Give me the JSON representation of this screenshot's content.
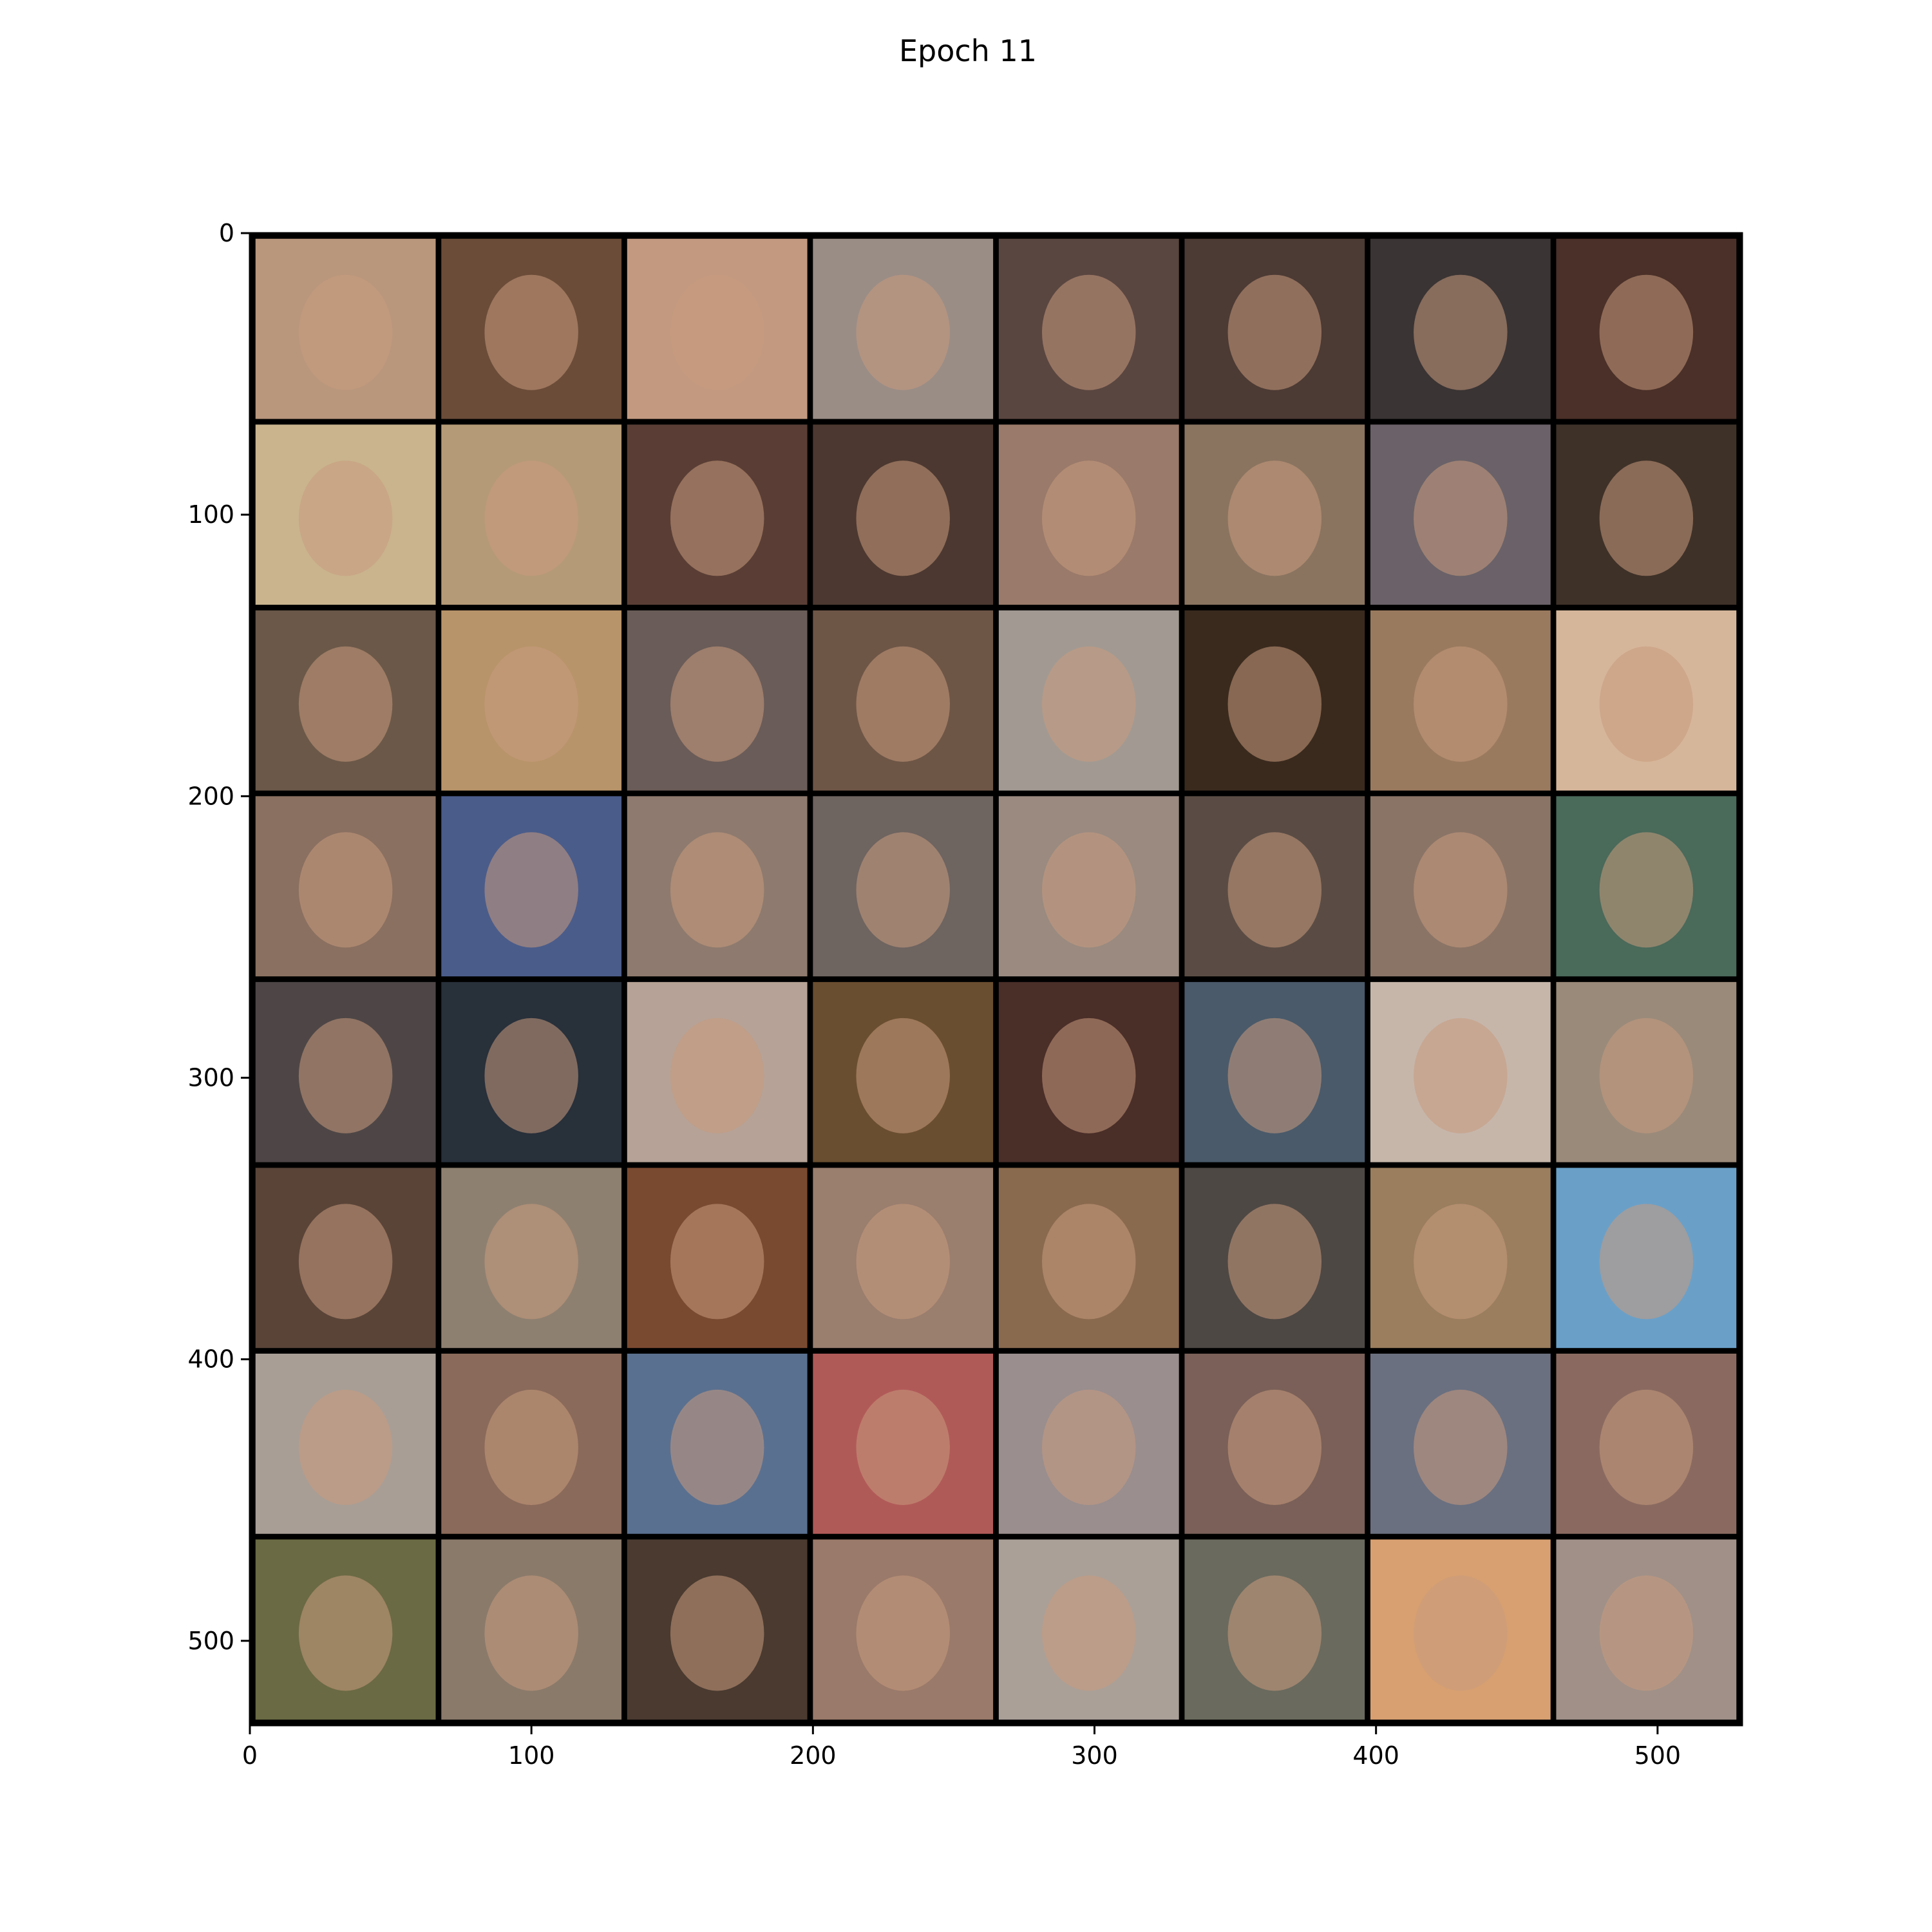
{
  "chart_data": {
    "type": "image-grid",
    "title": "Epoch 11",
    "xlabel": "",
    "ylabel": "",
    "xlim": [
      0,
      530
    ],
    "ylim": [
      530,
      0
    ],
    "xticks": [
      0,
      100,
      200,
      300,
      400,
      500
    ],
    "yticks": [
      0,
      100,
      200,
      300,
      400,
      500
    ],
    "grid_rows": 8,
    "grid_cols": 8,
    "tile_size": 64,
    "padding": 2,
    "cells": [
      [
        "#b9977c",
        "#6b4c38",
        "#c39a80",
        "#9a8d86",
        "#5a4640",
        "#4c3a34",
        "#3a3434",
        "#4a3028"
      ],
      [
        "#c9b48e",
        "#b59a77",
        "#5a3e35",
        "#4c3830",
        "#9a7a6a",
        "#8a7460",
        "#6a6268",
        "#3e3128"
      ],
      [
        "#6b5848",
        "#b8946a",
        "#6a5c58",
        "#6e5646",
        "#a29a92",
        "#3a2a1e",
        "#9a7a5e",
        "#d6b69a"
      ],
      [
        "#8a7060",
        "#4a5c8a",
        "#8e7a6e",
        "#6e6460",
        "#9a8a80",
        "#5a4c44",
        "#8a7466",
        "#4a6a5a"
      ],
      [
        "#4e4646",
        "#28303a",
        "#b6a296",
        "#6a4e30",
        "#4a2e28",
        "#4a5a6a",
        "#c6b6aa",
        "#9a8a7a"
      ],
      [
        "#5a4438",
        "#8e8070",
        "#7a4a30",
        "#9a7e6e",
        "#8a6a4e",
        "#4e4844",
        "#9a7e5e",
        "#6aa0c8"
      ],
      [
        "#a89e96",
        "#8a6a5a",
        "#5a7090",
        "#b05a58",
        "#9a8e8e",
        "#7a6058",
        "#6a7080",
        "#8a6a60"
      ],
      [
        "#6a6a44",
        "#8a7a6a",
        "#4a3a30",
        "#9a7a6a",
        "#aaa098",
        "#6a6a5e",
        "#d8a070",
        "#a09088"
      ]
    ]
  }
}
